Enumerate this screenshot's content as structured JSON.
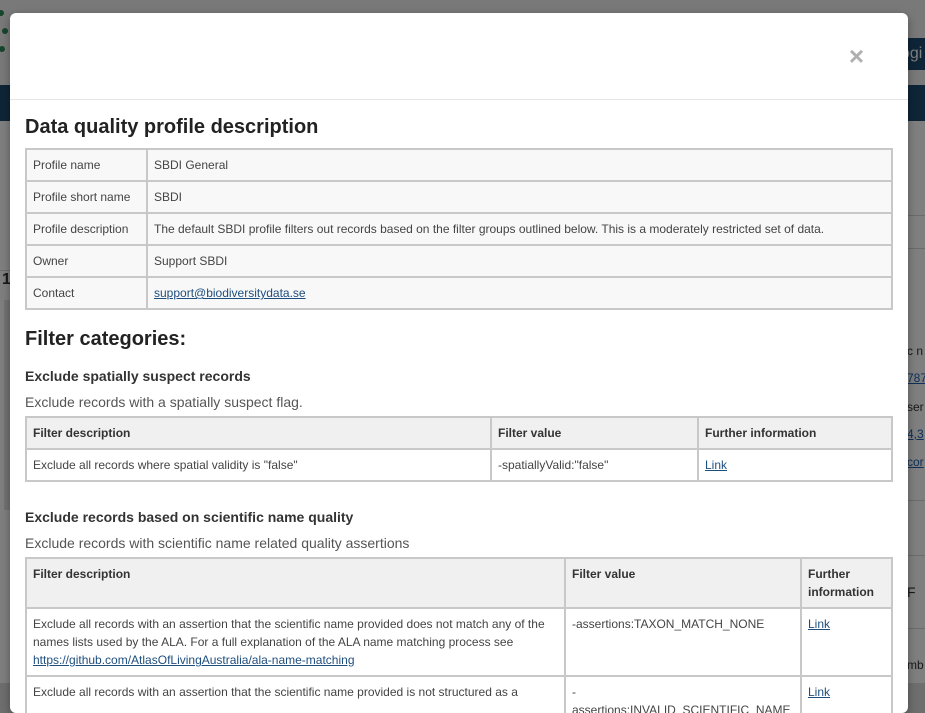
{
  "background": {
    "login_fragment": "ogi",
    "left_digit": "1",
    "right_fragments": [
      {
        "text": "c n",
        "link": false
      },
      {
        "text": "787",
        "link": true
      },
      {
        "text": "ser",
        "link": false
      },
      {
        "text": "4,3",
        "link": true
      },
      {
        "text": "cor",
        "link": true
      },
      {
        "text": "F",
        "link": false
      },
      {
        "text": "mb",
        "link": false
      }
    ]
  },
  "modal": {
    "close_symbol": "×",
    "title": "Data quality profile description",
    "profile": [
      {
        "key": "Profile name",
        "value": "SBDI General"
      },
      {
        "key": "Profile short name",
        "value": "SBDI"
      },
      {
        "key": "Profile description",
        "value": "The default SBDI profile filters out records based on the filter groups outlined below. This is a moderately restricted set of data."
      },
      {
        "key": "Owner",
        "value": "Support SBDI"
      },
      {
        "key": "Contact",
        "value": "support@biodiversitydata.se"
      }
    ],
    "filter_categories_heading": "Filter categories:",
    "groups": [
      {
        "name": "Exclude spatially suspect records",
        "description": "Exclude records with a spatially suspect flag.",
        "headers": {
          "desc": "Filter description",
          "value": "Filter value",
          "info": "Further information"
        },
        "rows": [
          {
            "desc": "Exclude all records where spatial validity is \"false\"",
            "value": "-spatiallyValid:\"false\"",
            "info": "Link"
          }
        ]
      },
      {
        "name": "Exclude records based on scientific name quality",
        "description": "Exclude records with scientific name related quality assertions",
        "headers": {
          "desc": "Filter description",
          "value": "Filter value",
          "info": "Further information"
        },
        "rows": [
          {
            "desc": "Exclude all records with an assertion that the scientific name provided does not match any of the names lists used by the ALA. For a full explanation of the ALA name matching process see",
            "desc_link": "https://github.com/AtlasOfLivingAustralia/ala-name-matching",
            "value": "-assertions:TAXON_MATCH_NONE",
            "info": "Link"
          },
          {
            "desc": "Exclude all records with an assertion that the scientific name provided is not structured as a",
            "value": "-assertions:INVALID_SCIENTIFIC_NAME",
            "info": "Link"
          }
        ]
      }
    ]
  }
}
